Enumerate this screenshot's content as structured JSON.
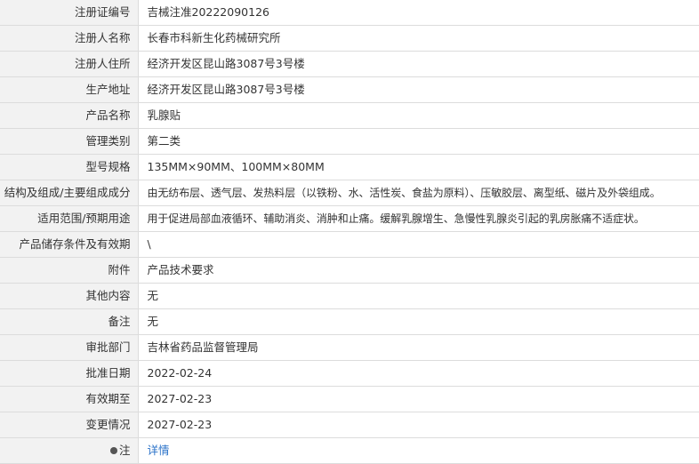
{
  "rows": [
    {
      "label": "注册证编号",
      "value": "吉械注准20222090126"
    },
    {
      "label": "注册人名称",
      "value": "长春市科新生化药械研究所"
    },
    {
      "label": "注册人住所",
      "value": "经济开发区昆山路3087号3号楼"
    },
    {
      "label": "生产地址",
      "value": "经济开发区昆山路3087号3号楼"
    },
    {
      "label": "产品名称",
      "value": "乳腺贴"
    },
    {
      "label": "管理类别",
      "value": "第二类"
    },
    {
      "label": "型号规格",
      "value": "135MM×90MM、100MM×80MM"
    },
    {
      "label": "结构及组成/主要组成成分",
      "value": "由无纺布层、透气层、发热料层（以铁粉、水、活性炭、食盐为原料）、压敏胶层、离型纸、磁片及外袋组成。"
    },
    {
      "label": "适用范围/预期用途",
      "value": "用于促进局部血液循环、辅助消炎、消肿和止痛。缓解乳腺增生、急慢性乳腺炎引起的乳房胀痛不适症状。"
    },
    {
      "label": "产品储存条件及有效期",
      "value": "\\"
    },
    {
      "label": "附件",
      "value": "产品技术要求"
    },
    {
      "label": "其他内容",
      "value": "无"
    },
    {
      "label": "备注",
      "value": "无"
    },
    {
      "label": "审批部门",
      "value": "吉林省药品监督管理局"
    },
    {
      "label": "批准日期",
      "value": "2022-02-24"
    },
    {
      "label": "有效期至",
      "value": "2027-02-23"
    },
    {
      "label": "变更情况",
      "value": "2027-02-23"
    }
  ],
  "note": {
    "label": "注",
    "icon": "note-pin-icon",
    "link_text": "详情",
    "link_color": "#2a72c8"
  }
}
